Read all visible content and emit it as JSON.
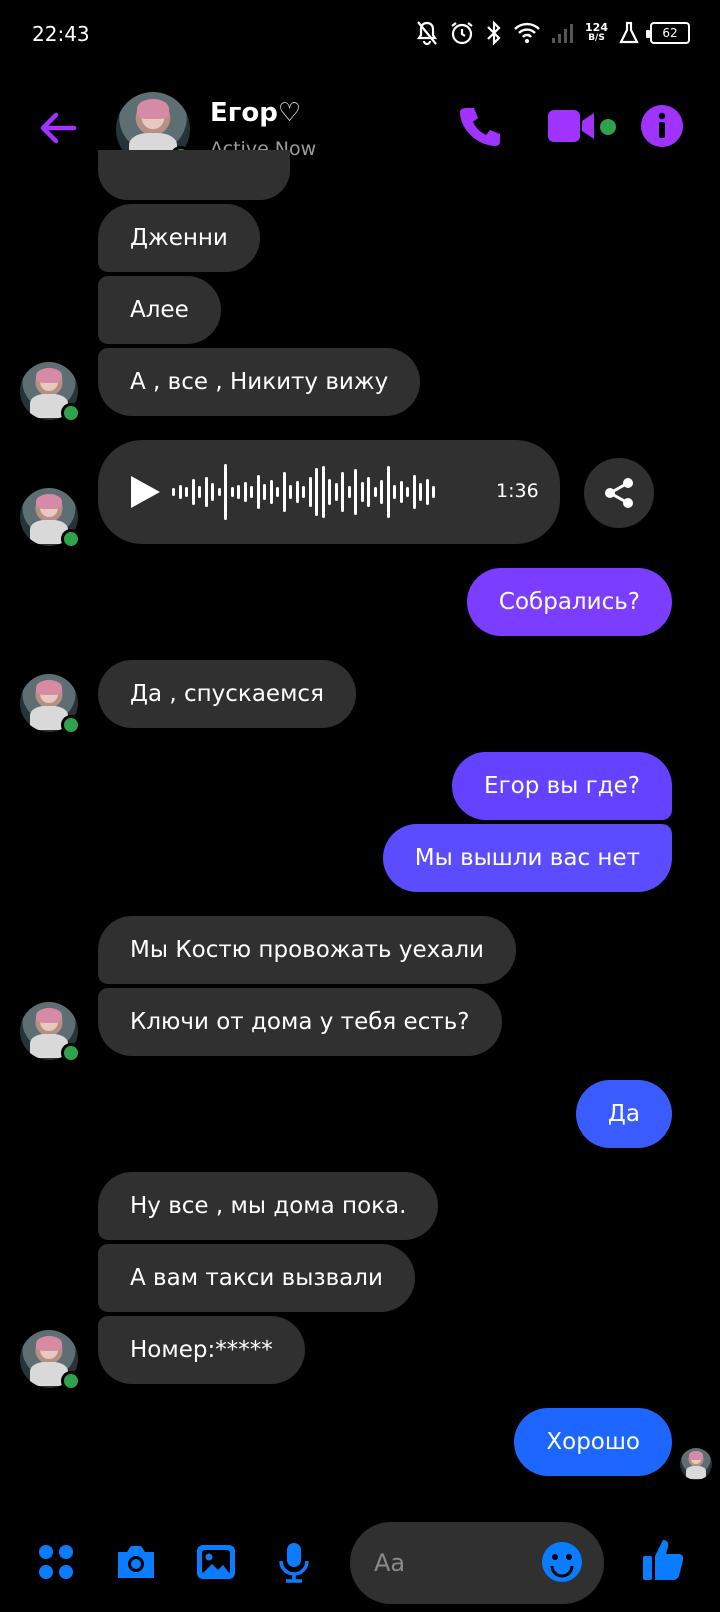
{
  "status_bar": {
    "time": "22:43",
    "net_speed_value": "124",
    "net_speed_unit": "B/S",
    "battery": "62"
  },
  "header": {
    "contact_name": "Егор♡",
    "contact_status": "Active Now"
  },
  "messages": [
    {
      "direction": "in",
      "text": "Дженни"
    },
    {
      "direction": "in",
      "text": "Алее"
    },
    {
      "direction": "in",
      "text": "А , все , Никиту вижу"
    },
    {
      "direction": "in",
      "type": "voice",
      "duration": "1:36"
    },
    {
      "direction": "out",
      "text": "Собрались?"
    },
    {
      "direction": "in",
      "text": "Да , спускаемся"
    },
    {
      "direction": "out",
      "text": "Егор вы где?"
    },
    {
      "direction": "out",
      "text": "Мы вышли вас нет"
    },
    {
      "direction": "in",
      "text": "Мы Костю провожать уехали"
    },
    {
      "direction": "in",
      "text": "Ключи от дома у тебя есть?"
    },
    {
      "direction": "out",
      "text": "Да"
    },
    {
      "direction": "in",
      "text": "Ну все , мы дома пока."
    },
    {
      "direction": "in",
      "text": "А вам такси вызвали"
    },
    {
      "direction": "in",
      "text": "Номер:*****"
    },
    {
      "direction": "out",
      "text": "Хорошо"
    }
  ],
  "composer": {
    "placeholder": "Aa"
  },
  "colors": {
    "accent_purple": "#a033ff",
    "bubble_incoming": "#303030",
    "bubble_out_purple": "#7b3dff",
    "bubble_out_indigo": "#5b4cff",
    "bubble_out_blue": "#1d66ff",
    "online_green": "#31a24c",
    "toolbar_blue": "#0a7cff"
  },
  "icons": [
    "bell-off-icon",
    "alarm-icon",
    "bluetooth-icon",
    "wifi-icon",
    "signal-icon",
    "lab-icon",
    "battery-icon",
    "back-arrow-icon",
    "phone-icon",
    "video-camera-icon",
    "info-icon",
    "play-icon",
    "share-icon",
    "apps-icon",
    "camera-icon",
    "gallery-icon",
    "microphone-icon",
    "emoji-icon",
    "thumbs-up-icon"
  ]
}
